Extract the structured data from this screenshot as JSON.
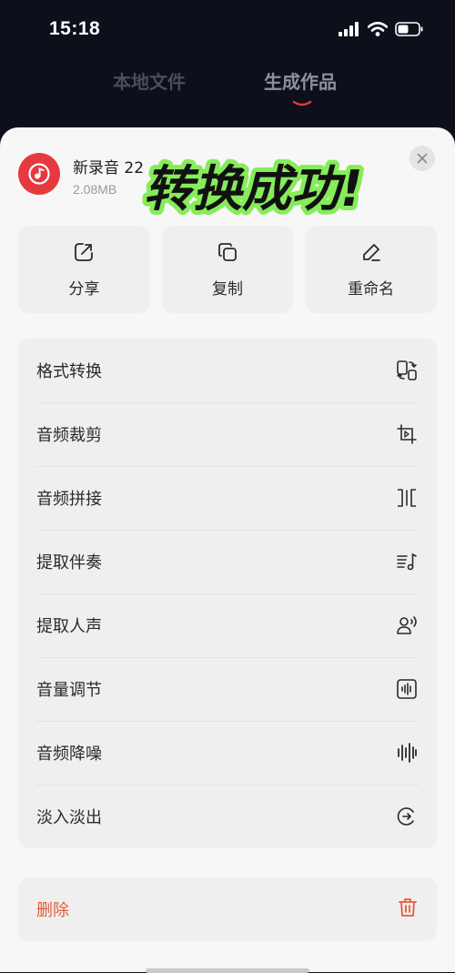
{
  "status_bar": {
    "time": "15:18",
    "icons": [
      "signal-icon",
      "wifi-icon",
      "battery-icon"
    ]
  },
  "top_tabs": [
    {
      "label": "本地文件",
      "active": false
    },
    {
      "label": "生成作品",
      "active": true
    }
  ],
  "file": {
    "name": "新录音 22",
    "size": "2.08MB",
    "icon": "music-note-icon",
    "accent_color": "#e6393f"
  },
  "overlay": {
    "text": "转换成功!"
  },
  "actions": [
    {
      "label": "分享",
      "icon": "share-icon"
    },
    {
      "label": "复制",
      "icon": "copy-icon"
    },
    {
      "label": "重命名",
      "icon": "rename-pencil-icon"
    }
  ],
  "menu": [
    {
      "label": "格式转换",
      "icon": "format-convert-icon"
    },
    {
      "label": "音频裁剪",
      "icon": "crop-icon"
    },
    {
      "label": "音频拼接",
      "icon": "splice-icon"
    },
    {
      "label": "提取伴奏",
      "icon": "accompaniment-icon"
    },
    {
      "label": "提取人声",
      "icon": "voice-person-icon"
    },
    {
      "label": "音量调节",
      "icon": "volume-adjust-icon"
    },
    {
      "label": "音频降噪",
      "icon": "noise-reduction-icon"
    },
    {
      "label": "淡入淡出",
      "icon": "fade-icon"
    }
  ],
  "delete": {
    "label": "删除",
    "icon": "trash-icon",
    "color": "#e35a3a"
  }
}
